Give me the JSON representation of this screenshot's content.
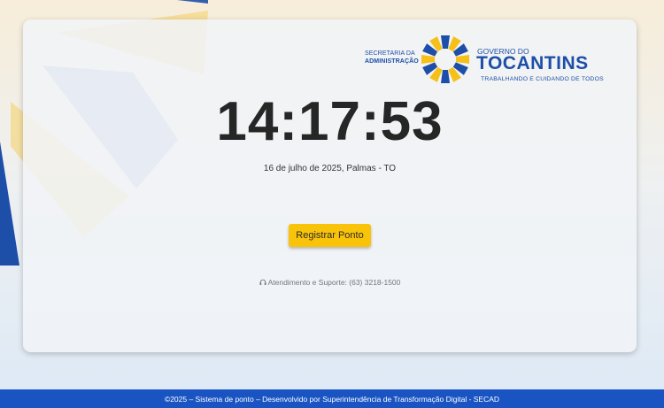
{
  "logo": {
    "secretaria_top": "SECRETARIA DA",
    "secretaria_bottom": "ADMINISTRAÇÃO",
    "governo_small": "GOVERNO DO",
    "governo_big": "TOCANTINS",
    "tagline": "TRABALHANDO E CUIDANDO DE TODOS",
    "emblem_icon": "sun-emblem-icon"
  },
  "clock": {
    "time": "14:17:53",
    "date": "16 de julho de 2025, Palmas - TO"
  },
  "actions": {
    "register_label": "Registrar Ponto"
  },
  "support": {
    "icon": "headset-icon",
    "text": "Atendimento e Suporte: (63) 3218-1500"
  },
  "footer": {
    "text": "©2025 – Sistema de ponto – Desenvolvido por Superintendência de Transformação Digital - SECAD"
  },
  "colors": {
    "brand_blue": "#1d4fa8",
    "accent_yellow": "#f9c309",
    "footer_blue": "#1a54c3",
    "shape_yellow": "#f6cf63",
    "shape_blue": "#8facdc"
  }
}
